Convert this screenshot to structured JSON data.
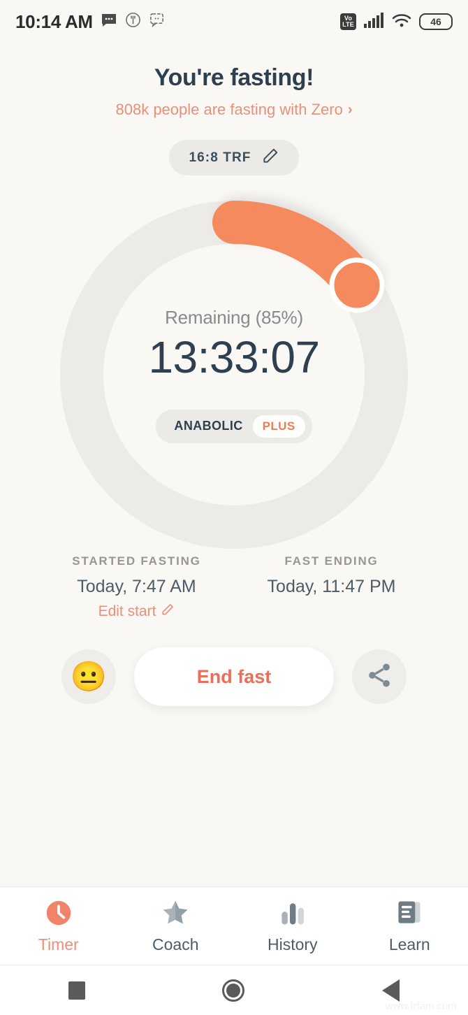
{
  "status_bar": {
    "time": "10:14 AM",
    "icons_left": [
      "messages-icon",
      "food-tracker-icon",
      "chat-icon"
    ],
    "volte_top": "Vo",
    "volte_bottom": "LTE",
    "icons_right": [
      "volte-icon",
      "cellular-signal-icon",
      "wifi-icon"
    ],
    "battery_level": "46"
  },
  "header": {
    "title": "You're fasting!",
    "community_text": "808k people are fasting with Zero",
    "community_chevron": "›",
    "plan_label": "16:8 TRF",
    "plan_edit_icon": "pencil-icon"
  },
  "ring": {
    "remaining_label": "Remaining (85%)",
    "timer_value": "13:33:07",
    "stage_name": "ANABOLIC",
    "plus_badge": "PLUS",
    "percent_complete": 15,
    "percent_remaining": 85,
    "track_color": "#EDEBE7",
    "progress_color": "#F68A5F",
    "knob_border_color": "#FFFFFF"
  },
  "times": {
    "start": {
      "heading": "STARTED FASTING",
      "value": "Today, 7:47 AM",
      "edit_label": "Edit start",
      "edit_icon": "pencil-icon"
    },
    "end": {
      "heading": "FAST ENDING",
      "value": "Today, 11:47 PM"
    }
  },
  "actions": {
    "mood_emoji": "😐",
    "mood_name": "neutral-face-emoji",
    "end_fast_label": "End fast",
    "share_icon": "share-icon"
  },
  "tabs": [
    {
      "label": "Timer",
      "icon": "timer-icon",
      "active": true
    },
    {
      "label": "Coach",
      "icon": "star-icon",
      "active": false
    },
    {
      "label": "History",
      "icon": "bar-chart-icon",
      "active": false
    },
    {
      "label": "Learn",
      "icon": "book-icon",
      "active": false
    }
  ],
  "nav_bar": {
    "recents": "square-icon",
    "home": "circle-icon",
    "back": "triangle-back-icon"
  },
  "watermark": "www.frfam.com",
  "colors": {
    "background": "#FAF8F4",
    "accent": "#E8907A",
    "accent_strong": "#F07C54",
    "text_dark": "#2E4050",
    "text_muted": "#8A8A8A"
  }
}
